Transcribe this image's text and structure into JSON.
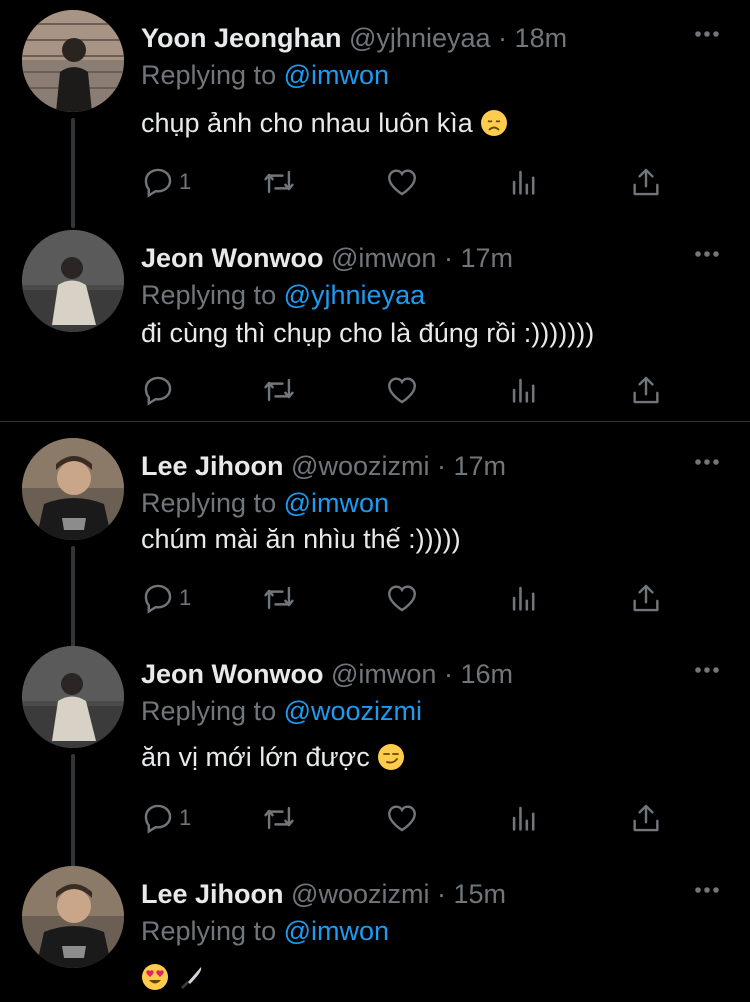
{
  "tweets": [
    {
      "name": "Yoon Jeonghan",
      "handle": "@yjhnieyaa",
      "separator": "·",
      "time": "18m",
      "replying_prefix": "Replying to",
      "replying_to": "@imwon",
      "text": "chụp ảnh cho nhau luôn kìa",
      "emoji": "disappointed-face",
      "reply_count": "1"
    },
    {
      "name": "Jeon Wonwoo",
      "handle": "@imwon",
      "separator": "·",
      "time": "17m",
      "replying_prefix": "Replying to",
      "replying_to": "@yjhnieyaa",
      "text": "đi cùng thì chụp cho là đúng rồi :)))))))",
      "reply_count": ""
    },
    {
      "name": "Lee Jihoon",
      "handle": "@woozizmi",
      "separator": "·",
      "time": "17m",
      "replying_prefix": "Replying to",
      "replying_to": "@imwon",
      "text": "chúm mài ăn nhìu thế :)))))",
      "reply_count": "1"
    },
    {
      "name": "Jeon Wonwoo",
      "handle": "@imwon",
      "separator": "·",
      "time": "16m",
      "replying_prefix": "Replying to",
      "replying_to": "@woozizmi",
      "text": "ăn vị mới lớn được",
      "emoji": "smirking-face",
      "reply_count": "1"
    },
    {
      "name": "Lee Jihoon",
      "handle": "@woozizmi",
      "separator": "·",
      "time": "15m",
      "replying_prefix": "Replying to",
      "replying_to": "@imwon",
      "text": "",
      "emoji": "heart-eyes-face, knife",
      "reply_count": ""
    }
  ],
  "icons": [
    "reply-icon",
    "retweet-icon",
    "like-icon",
    "analytics-icon",
    "share-icon",
    "more-icon"
  ],
  "colors": {
    "background": "#000000",
    "name": "#e7e9ea",
    "secondary": "#71767b",
    "mention": "#1d9bf0",
    "divider": "#2f3336"
  }
}
